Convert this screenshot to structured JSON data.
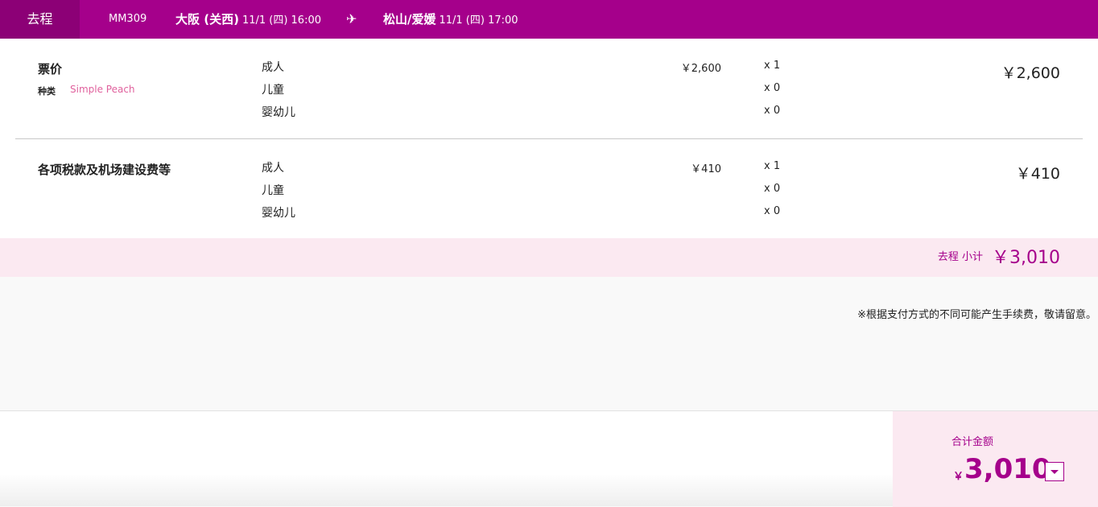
{
  "header": {
    "tab_label": "去程",
    "flight_number": "MM309",
    "origin_city": "大阪 (关西)",
    "origin_datetime": "11/1 (四) 16:00",
    "plane_icon": "airplane-icon",
    "destination_city": "松山/爱媛",
    "destination_datetime": "11/1 (四) 17:00"
  },
  "fare": {
    "title": "票价",
    "type_label": "种类",
    "type_value": "Simple Peach",
    "rows": [
      {
        "label": "成人",
        "unit_price": "￥2,600",
        "qty": "x 1"
      },
      {
        "label": "儿童",
        "unit_price": "",
        "qty": "x 0"
      },
      {
        "label": "婴幼儿",
        "unit_price": "",
        "qty": "x 0"
      }
    ],
    "total": "￥2,600"
  },
  "taxes": {
    "title": "各项税款及机场建设费等",
    "rows": [
      {
        "label": "成人",
        "unit_price": "￥410",
        "qty": "x 1"
      },
      {
        "label": "儿童",
        "unit_price": "",
        "qty": "x 0"
      },
      {
        "label": "婴幼儿",
        "unit_price": "",
        "qty": "x 0"
      }
    ],
    "total": "￥410"
  },
  "subtotal": {
    "label": "去程 小计",
    "amount": "￥3,010"
  },
  "note": "※根据支付方式的不同可能产生手续费，敬请留意。",
  "summary": {
    "label": "合计金额",
    "currency": "￥",
    "amount": "3,010",
    "expand_icon": "chevron-down-icon"
  },
  "colors": {
    "brand": "#a5008b",
    "brand_light": "#fbe9f1",
    "accent_pink": "#e0619d"
  }
}
